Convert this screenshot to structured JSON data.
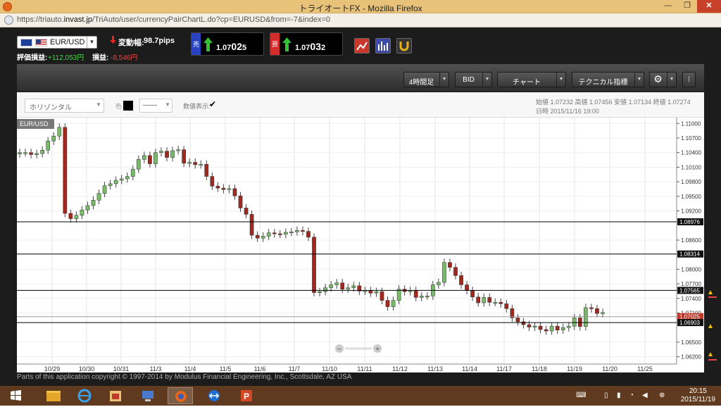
{
  "window": {
    "title": "トライオートFX - Mozilla Firefox",
    "url_prefix": "https://triauto.",
    "url_domain": "invast.jp",
    "url_rest": "/TriAuto/user/currencyPairChartL.do?cp=EURUSD&from=-7&index=0"
  },
  "header": {
    "pair": "EUR/USD",
    "change_label": "変動幅:",
    "change_value": "98.7pips",
    "pl_label": "評価損益:",
    "pl_value": "+112,053円",
    "loss_label": "損益:",
    "loss_value": "-8,546円",
    "sell": {
      "side": "売",
      "prefix": "1.07",
      "big": "02",
      "suffix": "5"
    },
    "buy": {
      "side": "買",
      "prefix": "1.07",
      "big": "03",
      "suffix": "2"
    }
  },
  "toolbar": {
    "timeframe": "4時間足",
    "price_type": "BID",
    "chart": "チャート",
    "technical": "テクニカル指標",
    "settings_icon": "gear-icon"
  },
  "drawbar": {
    "tool": "ホリゾンタル",
    "color_label": "色",
    "line_style": "——",
    "numeric_label": "数値表示:",
    "numeric_checked": true
  },
  "ohlc": {
    "line1": "始値 1.07232 高値 1.07456 安値 1.07134 終値 1.07274",
    "line2": "日時 2015/11/16 19:00"
  },
  "chart_data": {
    "type": "candlestick",
    "title": "EUR/USD",
    "ylim": [
      1.0605,
      1.1112
    ],
    "y_ticks": [
      "1.11000",
      "1.10700",
      "1.10400",
      "1.10100",
      "1.09800",
      "1.09500",
      "1.09200",
      "1.08600",
      "1.08000",
      "1.07700",
      "1.07400",
      "1.07100",
      "1.06500",
      "1.06200"
    ],
    "x_ticks": [
      "10/29",
      "10/30",
      "10/31",
      "11/3",
      "11/4",
      "11/5",
      "11/6",
      "11/7",
      "11/10",
      "11/11",
      "11/12",
      "11/13",
      "11/14",
      "11/17",
      "11/18",
      "11/19",
      "11/20",
      "11/25"
    ],
    "horizontal_lines": [
      {
        "value": "1.08976"
      },
      {
        "value": "1.08314"
      },
      {
        "value": "1.07565"
      },
      {
        "value": "1.07025"
      },
      {
        "value": "1.06903"
      }
    ],
    "current_price": "1.07025",
    "candles_close": [
      1.104,
      1.104,
      1.1036,
      1.1038,
      1.1045,
      1.1064,
      1.1074,
      1.1092,
      1.0915,
      1.0904,
      1.0911,
      1.0922,
      1.0931,
      1.0942,
      1.0956,
      1.0972,
      1.0976,
      1.0983,
      1.0986,
      1.0991,
      1.1006,
      1.1026,
      1.1034,
      1.1017,
      1.104,
      1.1043,
      1.103,
      1.1044,
      1.1046,
      1.1018,
      1.102,
      1.1015,
      1.1016,
      1.0991,
      1.0971,
      1.0967,
      1.0964,
      1.0966,
      1.0951,
      1.0926,
      1.0913,
      1.087,
      1.0864,
      1.0868,
      1.0875,
      1.0873,
      1.0872,
      1.0876,
      1.0877,
      1.088,
      1.0878,
      1.0866,
      1.0752,
      1.0754,
      1.0762,
      1.0768,
      1.0772,
      1.0759,
      1.0762,
      1.0766,
      1.0755,
      1.0756,
      1.0751,
      1.0754,
      1.0736,
      1.0723,
      1.0736,
      1.0759,
      1.0754,
      1.0756,
      1.0742,
      1.0745,
      1.0745,
      1.0768,
      1.0773,
      1.0814,
      1.0804,
      1.0787,
      1.0768,
      1.0756,
      1.0743,
      1.0731,
      1.0742,
      1.0732,
      1.0732,
      1.0729,
      1.0719,
      1.07,
      1.0692,
      1.0686,
      1.0681,
      1.0683,
      1.0676,
      1.0673,
      1.0683,
      1.0675,
      1.068,
      1.0683,
      1.07,
      1.0682,
      1.0721,
      1.0719,
      1.0709,
      1.0711
    ]
  },
  "zoom": {
    "minus": "−",
    "plus": "+"
  },
  "footer": {
    "copyright": "Parts of this application copyright © 1997-2014 by Modulus Financial Engineering, Inc., Scottsdale, AZ USA"
  },
  "taskbar": {
    "time": "20:15",
    "date": "2015/11/19"
  },
  "colors": {
    "bear": "#a0281e",
    "bull": "#7ab86b",
    "line": "#000000",
    "current": "#c0392b"
  }
}
